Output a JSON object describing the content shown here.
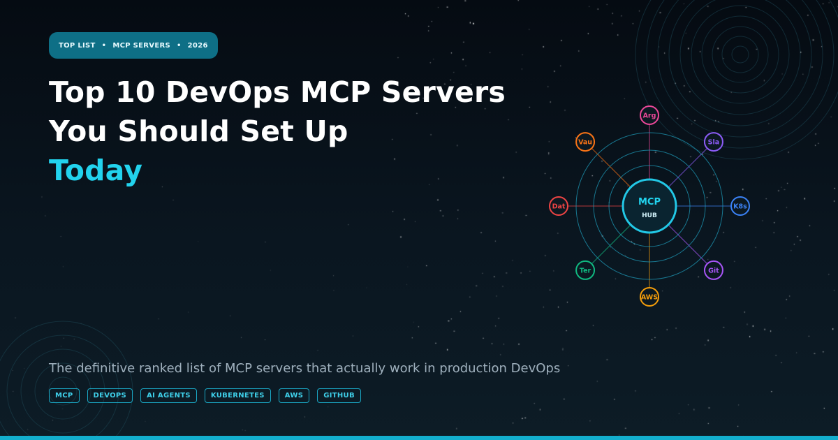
{
  "badge": {
    "items": [
      "TOP LIST",
      "MCP SERVERS",
      "2026"
    ],
    "separator": "•"
  },
  "title": {
    "line1": "Top 10 DevOps MCP Servers",
    "line2": "You Should Set Up",
    "accent": "Today"
  },
  "subtitle": "The definitive ranked list of MCP servers that actually work in production DevOps",
  "tags": [
    "MCP",
    "DEVOPS",
    "AI AGENTS",
    "KUBERNETES",
    "AWS",
    "GITHUB"
  ],
  "hub": {
    "label": "MCP",
    "sublabel": "HUB",
    "nodes": [
      {
        "label": "Arg",
        "color": "#ec4899"
      },
      {
        "label": "Sla",
        "color": "#8b5cf6"
      },
      {
        "label": "K8s",
        "color": "#3b82f6"
      },
      {
        "label": "Git",
        "color": "#a855f7"
      },
      {
        "label": "AWS",
        "color": "#f59e0b"
      },
      {
        "label": "Ter",
        "color": "#10b981"
      },
      {
        "label": "Dat",
        "color": "#ef4444"
      },
      {
        "label": "Vau",
        "color": "#f97316"
      }
    ]
  },
  "colors": {
    "accent": "#22d3ee",
    "badge_bg": "#0e6f86",
    "bottom_bar": "#13aecd"
  }
}
